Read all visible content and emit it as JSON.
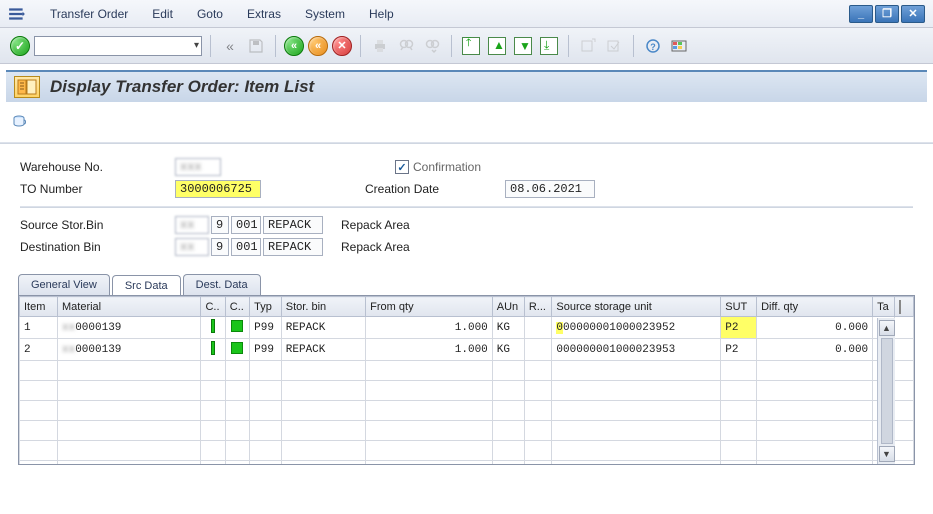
{
  "menu": {
    "items": [
      "Transfer Order",
      "Edit",
      "Goto",
      "Extras",
      "System",
      "Help"
    ]
  },
  "title": "Display Transfer Order: Item List",
  "header": {
    "warehouse_label": "Warehouse No.",
    "warehouse_val": "",
    "to_number_label": "TO Number",
    "to_number_val": "3000006725",
    "confirmation_label": "Confirmation",
    "creation_date_label": "Creation Date",
    "creation_date_val": "08.06.2021",
    "src_bin_label": "Source Stor.Bin",
    "src_bin_code": "9",
    "src_bin_num": "001",
    "src_bin_name": "REPACK",
    "src_bin_desc": "Repack Area",
    "dst_bin_label": "Destination Bin",
    "dst_bin_code": "9",
    "dst_bin_num": "001",
    "dst_bin_name": "REPACK",
    "dst_bin_desc": "Repack Area"
  },
  "tabs": [
    "General View",
    "Src Data",
    "Dest. Data"
  ],
  "active_tab": 1,
  "grid": {
    "cols": [
      "Item",
      "Material",
      "C..",
      "C..",
      "Typ",
      "Stor. bin",
      "From qty",
      "AUn",
      "R...",
      "Source storage unit",
      "SUT",
      "Diff. qty",
      "Ta"
    ],
    "rows": [
      {
        "item": "1",
        "material": "0000139",
        "typ": "P99",
        "bin": "REPACK",
        "qty": "1.000",
        "aun": "KG",
        "ssu": "00000001000023952",
        "sut": "P2",
        "diff": "0.000"
      },
      {
        "item": "2",
        "material": "0000139",
        "typ": "P99",
        "bin": "REPACK",
        "qty": "1.000",
        "aun": "KG",
        "ssu": "00000001000023953",
        "sut": "P2",
        "diff": "0.000"
      }
    ]
  }
}
